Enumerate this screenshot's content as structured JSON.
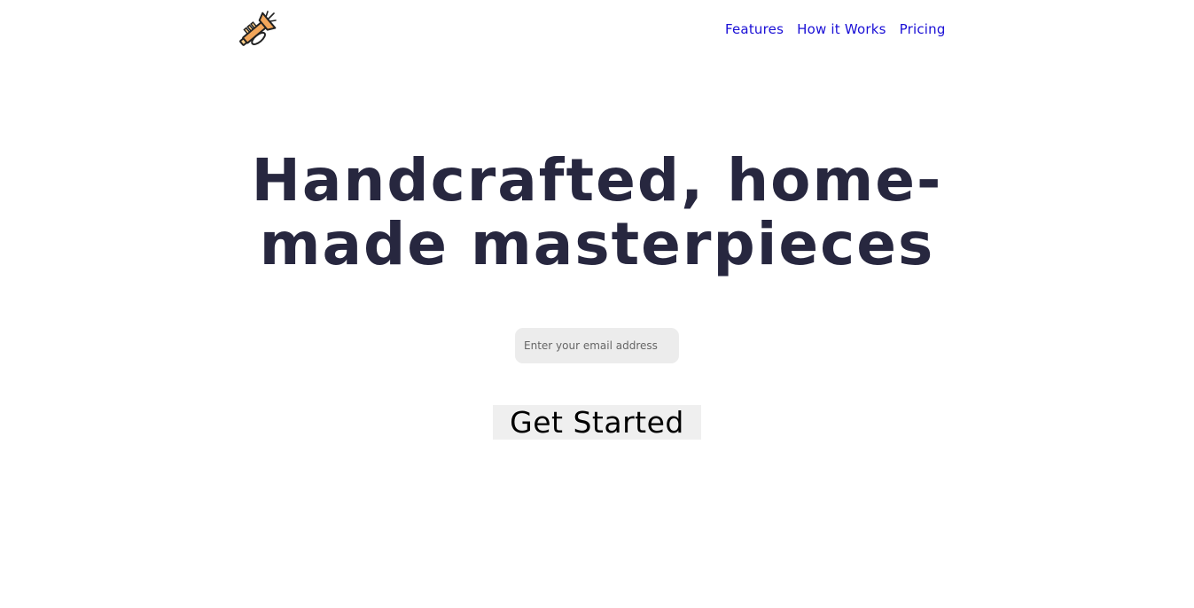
{
  "header": {
    "logo_icon": "trumpet-icon",
    "nav": [
      {
        "label": "Features"
      },
      {
        "label": "How it Works"
      },
      {
        "label": "Pricing"
      }
    ]
  },
  "hero": {
    "title": "Handcrafted, home-made masterpieces",
    "email_placeholder": "Enter your email address",
    "cta_label": "Get Started"
  },
  "colors": {
    "nav_link": "#1a0fd6",
    "headline": "#27273f",
    "input_background": "#ececec",
    "button_background": "#efefef"
  }
}
